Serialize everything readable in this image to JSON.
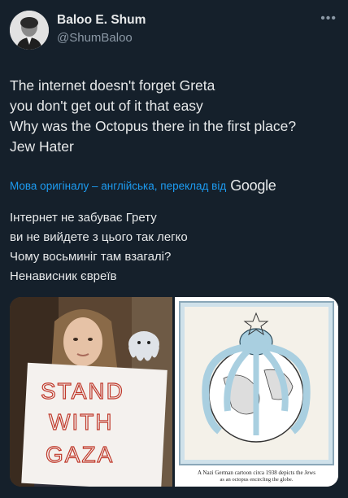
{
  "author": {
    "display_name": "Baloo E. Shum",
    "handle": "@ShumBaloo"
  },
  "more_icon": "more-horizontal-icon",
  "tweet": {
    "lines": [
      "The internet doesn't forget Greta",
      "you don't get out of  it that easy",
      "Why was the Octopus there in the first place?",
      "Jew Hater"
    ]
  },
  "translation": {
    "note": "Мова оригіналу – англійська, переклад від",
    "provider": "Google",
    "lines": [
      "Інтернет не забуває Грету",
      "ви не вийдете з цього так легко",
      "Чому восьминіг там взагалі?",
      "Ненависник євреїв"
    ]
  },
  "media": {
    "photo_sign_lines": [
      "STAND",
      "WITH",
      "GAZA"
    ],
    "cartoon_caption_line1": "A Nazi German cartoon circa 1938 depicts the Jews",
    "cartoon_caption_line2": "as an octopus encircling the globe."
  },
  "colors": {
    "background": "#15202b",
    "text": "#e7e9ea",
    "secondary_text": "#8b98a5",
    "link": "#1d9bf0"
  }
}
